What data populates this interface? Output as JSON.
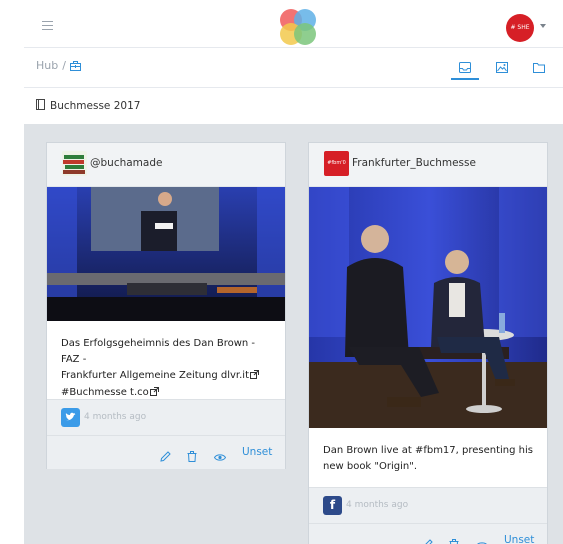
{
  "header": {
    "menu_icon": "hamburger-icon",
    "avatar_text": "# SHE"
  },
  "breadcrumb": {
    "root": "Hub",
    "separator": "/",
    "icon": "briefcase-icon"
  },
  "view_tabs": [
    {
      "icon": "inbox-icon",
      "active": true
    },
    {
      "icon": "image-icon",
      "active": false
    },
    {
      "icon": "folder-icon",
      "active": false
    }
  ],
  "page": {
    "title": "Buchmesse 2017",
    "title_icon": "document-icon"
  },
  "cards": [
    {
      "author": "@buchamade",
      "text_line1": "Das Erfolgsgeheimnis des Dan Brown - FAZ -",
      "text_line2": "Frankfurter Allgemeine Zeitung dlvr.it",
      "text_line3": "#Buchmesse t.co",
      "service": "twitter",
      "time": "4 months ago",
      "unset_label": "Unset"
    },
    {
      "author": "Frankfurter_Buchmesse",
      "author_badge": "#fbm'0",
      "text_line1": "Dan Brown live at #fbm17, presenting his",
      "text_line2": "new book \"Origin\".",
      "service": "facebook",
      "service_glyph": "f",
      "time": "4 months ago",
      "unset_label": "Unset"
    }
  ],
  "colors": {
    "accent": "#2f8fd8",
    "content_bg": "#dee2e6",
    "brand_red": "#d61f26"
  }
}
